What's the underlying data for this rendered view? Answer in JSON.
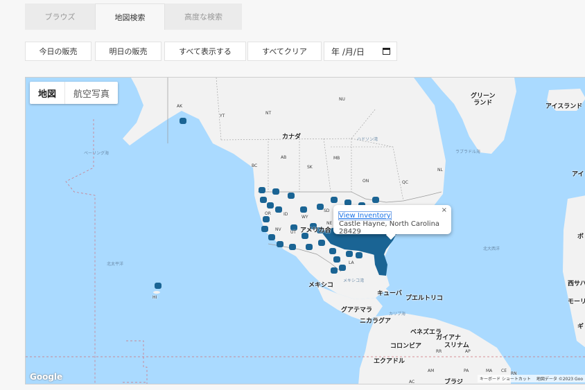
{
  "tabs": {
    "browse": "ブラウズ",
    "map_search": "地図検索",
    "advanced_search": "高度な検索"
  },
  "toolbar": {
    "today_sales": "今日の販売",
    "tomorrow_sales": "明日の販売",
    "show_all": "すべて表示する",
    "clear_all": "すべてクリア",
    "date_placeholder": "年 /月/日"
  },
  "map": {
    "type_map": "地図",
    "type_satellite": "航空写真",
    "popup": {
      "link": "View Inventory",
      "address": "Castle Hayne, North Carolina 28429",
      "close": "×"
    },
    "labels": {
      "greenland": "グリーン\nランド",
      "iceland": "アイスランド",
      "canada": "カナダ",
      "usa": "アメリカ合",
      "mexico": "メキシコ",
      "cuba": "キューバ",
      "puerto_rico": "プエルトリコ",
      "guatemala": "グアテマラ",
      "nicaragua": "ニカラグア",
      "venezuela": "ベネズエラ",
      "guyana": "ガイアナ",
      "suriname": "スリナム",
      "colombia": "コロンビア",
      "ecuador": "エクアドル",
      "brazil": "ブラジ",
      "ak": "AK",
      "yt": "YT",
      "nt": "NT",
      "nu": "NU",
      "bc": "BC",
      "ab": "AB",
      "sk": "SK",
      "mb": "MB",
      "on": "ON",
      "qc": "QC",
      "nl": "NL",
      "or": "OR",
      "id": "ID",
      "wy": "WY",
      "sd": "SD",
      "nv": "NV",
      "ut": "UT",
      "ne": "NE",
      "la": "LA",
      "hi": "HI",
      "rr": "RR",
      "ap": "AP",
      "am": "AM",
      "pa": "PA",
      "ma": "MA",
      "ce": "CE",
      "rn": "RN",
      "ac": "AC",
      "ai": "アイ",
      "bo": "ボ",
      "nishi": "西サハ",
      "mo": "モーリ",
      "gi": "ギ",
      "north_pacific": "北太平洋",
      "north_atlantic": "北大西洋",
      "bering": "ベーリング海",
      "hudson": "ハドソン湾",
      "labrador": "ラブラドル海",
      "mexico_gulf": "メキシコ湾",
      "caribbean": "カリブ海"
    },
    "attribution": {
      "logo": "Google",
      "shortcuts": "キーボード ショートカット",
      "data": "地図データ ©2023 Goo"
    }
  },
  "colors": {
    "water": "#aadaff",
    "land": "#f2f2f2",
    "marker": "#1a6494",
    "tab_bg": "#ebebeb"
  }
}
